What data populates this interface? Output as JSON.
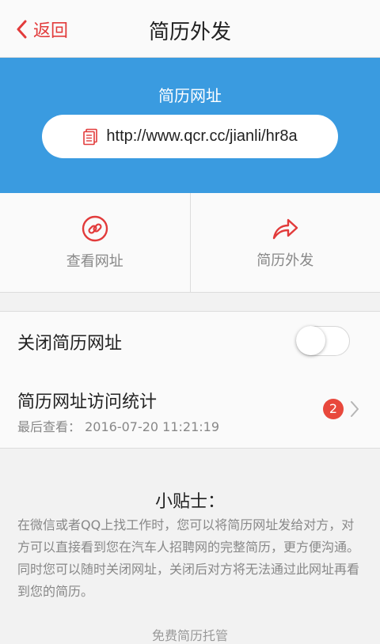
{
  "header": {
    "back_label": "返回",
    "title": "简历外发"
  },
  "banner": {
    "title": "简历网址",
    "url": "http://www.qcr.cc/jianli/hr8a"
  },
  "actions": [
    {
      "label": "查看网址",
      "icon": "link-icon"
    },
    {
      "label": "简历外发",
      "icon": "share-arrow-icon"
    }
  ],
  "toggle_row": {
    "label": "关闭简历网址",
    "state": "off"
  },
  "stats_row": {
    "label": "简历网址访问统计",
    "sub_label": "最后查看：",
    "last_viewed": "2016-07-20 11:21:19",
    "badge": "2"
  },
  "tips": {
    "title": "小贴士：",
    "body": "在微信或者QQ上找工作时，您可以将简历网址发给对方，对方可以直接看到您在汽车人招聘网的完整简历，更方便沟通。同时您可以随时关闭网址，关闭后对方将无法通过此网址再看到您的简历。"
  },
  "footer": {
    "text": "免费简历托管"
  },
  "colors": {
    "accent": "#e23b3b",
    "banner": "#3a9be0",
    "badge": "#e8483c"
  }
}
